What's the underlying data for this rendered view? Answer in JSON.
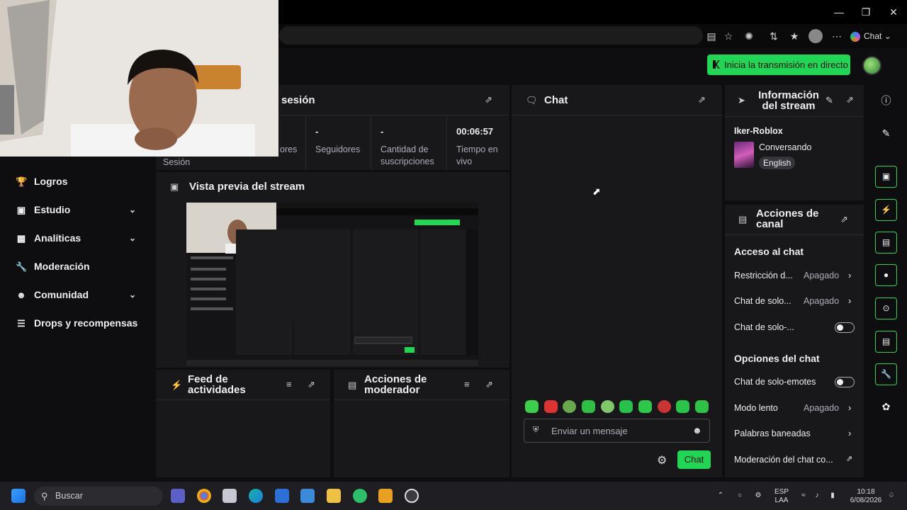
{
  "browser": {
    "copilot_label": "Chat"
  },
  "header": {
    "go_live": "Inicia la transmisión en directo"
  },
  "sidebar": {
    "items": [
      {
        "label": "Logros",
        "icon": "trophy-icon"
      },
      {
        "label": "Estudio",
        "icon": "studio-icon"
      },
      {
        "label": "Analíticas",
        "icon": "chart-icon"
      },
      {
        "label": "Moderación",
        "icon": "wrench-icon"
      },
      {
        "label": "Comunidad",
        "icon": "people-icon"
      },
      {
        "label": "Drops y recompensas",
        "icon": "drops-icon"
      }
    ]
  },
  "session": {
    "title": "sesión",
    "label_session": "Sesión",
    "stats": [
      {
        "value": "",
        "label": "ores"
      },
      {
        "value": "-",
        "label": "Seguidores"
      },
      {
        "value": "-",
        "label": "Cantidad de suscripciones"
      },
      {
        "value": "00:06:57",
        "label": "Tiempo en vivo"
      }
    ]
  },
  "preview": {
    "title": "Vista previa del stream"
  },
  "activity": {
    "title": "Feed de actividades"
  },
  "modactions": {
    "title": "Acciones de moderador"
  },
  "chat": {
    "title": "Chat",
    "placeholder": "Enviar un mensaje",
    "send": "Chat"
  },
  "streaminfo": {
    "title": "Información del stream",
    "channel": "Iker-Roblox",
    "category": "Conversando",
    "tag": "English"
  },
  "channelactions": {
    "title": "Acciones de canal",
    "chat_access": "Acceso al chat",
    "restriction": "Restricción d...",
    "restriction_value": "Apagado",
    "solo1": "Chat de solo...",
    "solo1_value": "Apagado",
    "solo2": "Chat de solo-...",
    "chat_options": "Opciones del chat",
    "emotes_only": "Chat de solo-emotes",
    "slow": "Modo lento",
    "slow_value": "Apagado",
    "banned": "Palabras baneadas",
    "modchat": "Moderación del chat co..."
  },
  "taskbar": {
    "search": "Buscar",
    "lang1": "ESP",
    "lang2": "LAA",
    "time": "10:18",
    "date": "6/08/2026"
  },
  "colors": {
    "accent": "#1fd655",
    "panel": "#18181b",
    "bg": "#0e0e10"
  }
}
